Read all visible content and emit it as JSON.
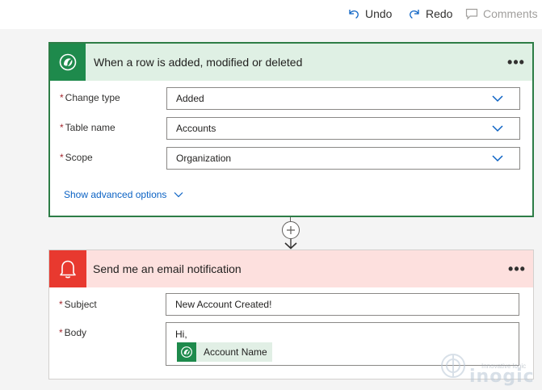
{
  "toolbar": {
    "undo_label": "Undo",
    "redo_label": "Redo",
    "comments_label": "Comments"
  },
  "trigger_card": {
    "title": "When a row is added, modified or deleted",
    "icon": "dataverse-icon",
    "more_label": "•••",
    "fields": [
      {
        "label": "Change type",
        "value": "Added"
      },
      {
        "label": "Table name",
        "value": "Accounts"
      },
      {
        "label": "Scope",
        "value": "Organization"
      }
    ],
    "required_marker": "*",
    "advanced_label": "Show advanced options"
  },
  "action_card": {
    "title": "Send me an email notification",
    "icon": "bell-icon",
    "more_label": "•••",
    "subject_label": "Subject",
    "subject_value": "New Account Created!",
    "body_label": "Body",
    "body_text": "Hi,",
    "token_label": "Account Name",
    "token_icon": "dataverse-icon",
    "required_marker": "*"
  },
  "watermark": {
    "small": "Innovative logic",
    "big": "inogic"
  },
  "colors": {
    "trigger_accent": "#1e8a4c",
    "trigger_header_bg": "#dff0e4",
    "action_accent": "#e8392f",
    "action_header_bg": "#fde0de",
    "link": "#0b62c4"
  }
}
